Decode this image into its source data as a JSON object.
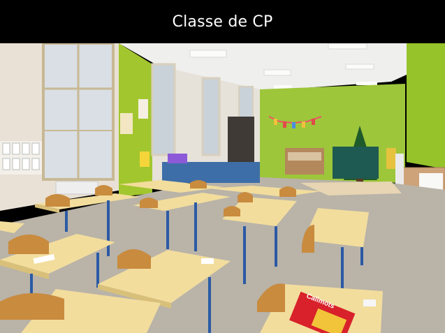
{
  "slide": {
    "title": "Classe de CP"
  },
  "photo": {
    "book_cover_text": "Calimots"
  }
}
